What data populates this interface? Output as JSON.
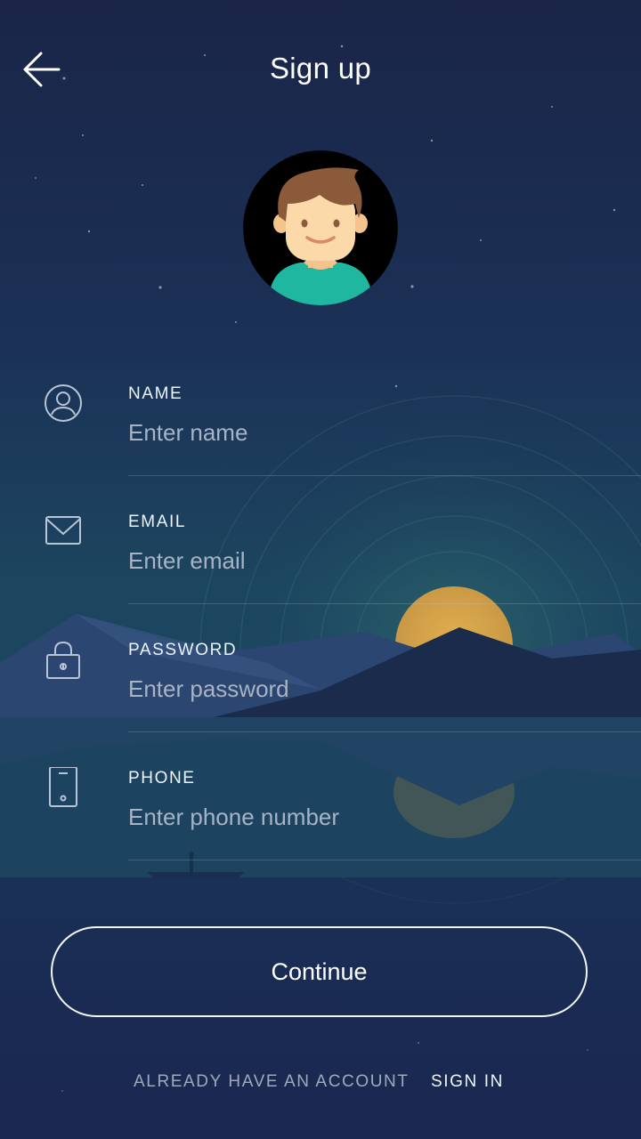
{
  "header": {
    "title": "Sign up",
    "back_icon": "arrow-left-icon"
  },
  "avatar": {
    "icon": "user-avatar-illustration",
    "shirt_color": "#1fb7a0",
    "hair_color": "#8a5a3a",
    "skin_color": "#fcd9a8"
  },
  "form": {
    "fields": [
      {
        "id": "name",
        "label": "NAME",
        "placeholder": "Enter name",
        "icon": "user-circle-icon"
      },
      {
        "id": "email",
        "label": "EMAIL",
        "placeholder": "Enter email",
        "icon": "mail-icon"
      },
      {
        "id": "password",
        "label": "PASSWORD",
        "placeholder": "Enter password",
        "icon": "lock-icon"
      },
      {
        "id": "phone",
        "label": "PHONE",
        "placeholder": "Enter phone number",
        "icon": "phone-icon"
      }
    ],
    "continue_label": "Continue"
  },
  "footer": {
    "prompt": "ALREADY HAVE AN ACCOUNT",
    "signin_label": "SIGN IN"
  },
  "colors": {
    "background_top": "#1a2548",
    "background_mid": "#1c4660",
    "sun": "#d9a94a",
    "mountains": "#1b2c4c"
  }
}
